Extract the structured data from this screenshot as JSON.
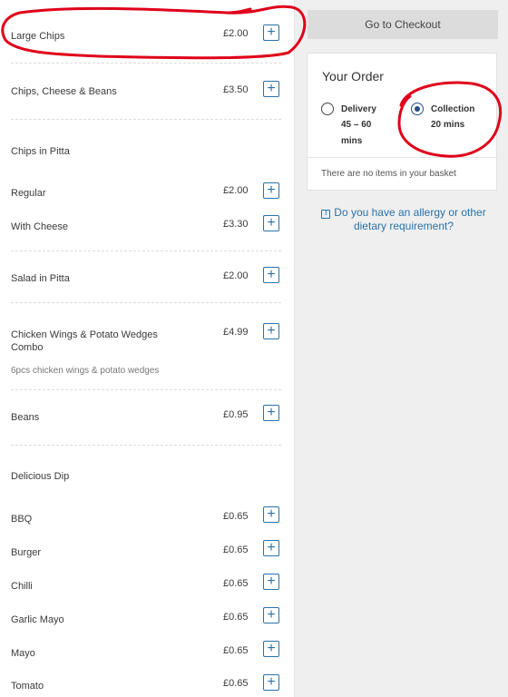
{
  "menu": {
    "items": [
      {
        "name": "Large Chips",
        "price": "£2.00"
      },
      {
        "name": "Chips, Cheese & Beans",
        "price": "£3.50"
      },
      {
        "name": "Regular",
        "price": "£2.00"
      },
      {
        "name": "With Cheese",
        "price": "£3.30"
      },
      {
        "name": "Salad in Pitta",
        "price": "£2.00"
      },
      {
        "name_line1": "Chicken Wings & Potato Wedges",
        "name_line2": "Combo",
        "price": "£4.99",
        "description": "6pcs chicken wings & potato wedges"
      },
      {
        "name": "Beans",
        "price": "£0.95"
      },
      {
        "name": "BBQ",
        "price": "£0.65"
      },
      {
        "name": "Burger",
        "price": "£0.65"
      },
      {
        "name": "Chilli",
        "price": "£0.65"
      },
      {
        "name": "Garlic Mayo",
        "price": "£0.65"
      },
      {
        "name": "Mayo",
        "price": "£0.65"
      },
      {
        "name": "Tomato",
        "price": "£0.65"
      }
    ],
    "headings": {
      "chips_in_pitta": "Chips in Pitta",
      "delicious_dip": "Delicious Dip"
    },
    "add_label": "+"
  },
  "sidebar": {
    "checkout_label": "Go to Checkout",
    "order_title": "Your Order",
    "delivery": {
      "label": "Delivery",
      "time": "45 – 60",
      "unit": "mins",
      "selected": false
    },
    "collection": {
      "label": "Collection",
      "time": "20 mins",
      "selected": true
    },
    "basket_empty": "There are no items in your basket",
    "allergy_line1": "Do you have an allergy or other",
    "allergy_line2": "dietary requirement?",
    "info_icon": "!"
  },
  "colors": {
    "accent": "#2a72a8",
    "annotation": "#e0001a",
    "radio_selected": "#1f4f86"
  }
}
